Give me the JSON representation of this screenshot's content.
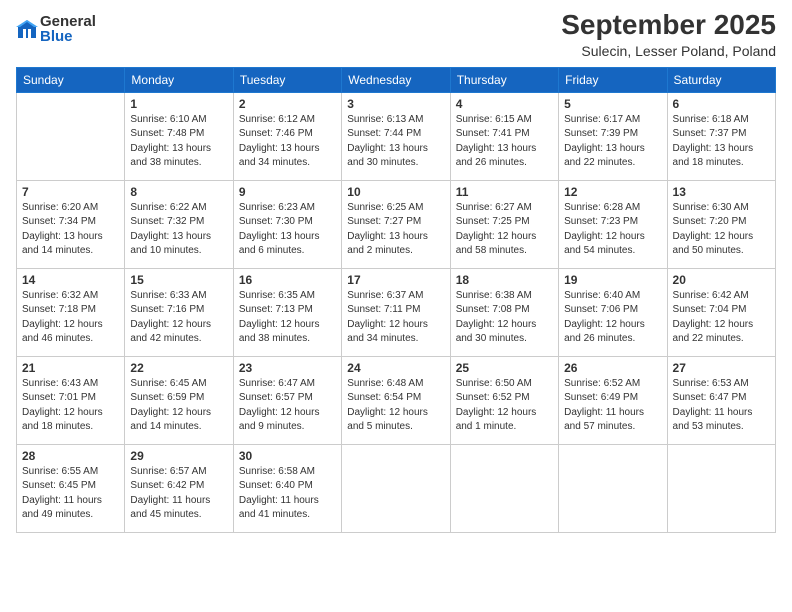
{
  "logo": {
    "general": "General",
    "blue": "Blue"
  },
  "header": {
    "month": "September 2025",
    "location": "Sulecin, Lesser Poland, Poland"
  },
  "days_of_week": [
    "Sunday",
    "Monday",
    "Tuesday",
    "Wednesday",
    "Thursday",
    "Friday",
    "Saturday"
  ],
  "weeks": [
    [
      {
        "day": "",
        "info": ""
      },
      {
        "day": "1",
        "info": "Sunrise: 6:10 AM\nSunset: 7:48 PM\nDaylight: 13 hours\nand 38 minutes."
      },
      {
        "day": "2",
        "info": "Sunrise: 6:12 AM\nSunset: 7:46 PM\nDaylight: 13 hours\nand 34 minutes."
      },
      {
        "day": "3",
        "info": "Sunrise: 6:13 AM\nSunset: 7:44 PM\nDaylight: 13 hours\nand 30 minutes."
      },
      {
        "day": "4",
        "info": "Sunrise: 6:15 AM\nSunset: 7:41 PM\nDaylight: 13 hours\nand 26 minutes."
      },
      {
        "day": "5",
        "info": "Sunrise: 6:17 AM\nSunset: 7:39 PM\nDaylight: 13 hours\nand 22 minutes."
      },
      {
        "day": "6",
        "info": "Sunrise: 6:18 AM\nSunset: 7:37 PM\nDaylight: 13 hours\nand 18 minutes."
      }
    ],
    [
      {
        "day": "7",
        "info": "Sunrise: 6:20 AM\nSunset: 7:34 PM\nDaylight: 13 hours\nand 14 minutes."
      },
      {
        "day": "8",
        "info": "Sunrise: 6:22 AM\nSunset: 7:32 PM\nDaylight: 13 hours\nand 10 minutes."
      },
      {
        "day": "9",
        "info": "Sunrise: 6:23 AM\nSunset: 7:30 PM\nDaylight: 13 hours\nand 6 minutes."
      },
      {
        "day": "10",
        "info": "Sunrise: 6:25 AM\nSunset: 7:27 PM\nDaylight: 13 hours\nand 2 minutes."
      },
      {
        "day": "11",
        "info": "Sunrise: 6:27 AM\nSunset: 7:25 PM\nDaylight: 12 hours\nand 58 minutes."
      },
      {
        "day": "12",
        "info": "Sunrise: 6:28 AM\nSunset: 7:23 PM\nDaylight: 12 hours\nand 54 minutes."
      },
      {
        "day": "13",
        "info": "Sunrise: 6:30 AM\nSunset: 7:20 PM\nDaylight: 12 hours\nand 50 minutes."
      }
    ],
    [
      {
        "day": "14",
        "info": "Sunrise: 6:32 AM\nSunset: 7:18 PM\nDaylight: 12 hours\nand 46 minutes."
      },
      {
        "day": "15",
        "info": "Sunrise: 6:33 AM\nSunset: 7:16 PM\nDaylight: 12 hours\nand 42 minutes."
      },
      {
        "day": "16",
        "info": "Sunrise: 6:35 AM\nSunset: 7:13 PM\nDaylight: 12 hours\nand 38 minutes."
      },
      {
        "day": "17",
        "info": "Sunrise: 6:37 AM\nSunset: 7:11 PM\nDaylight: 12 hours\nand 34 minutes."
      },
      {
        "day": "18",
        "info": "Sunrise: 6:38 AM\nSunset: 7:08 PM\nDaylight: 12 hours\nand 30 minutes."
      },
      {
        "day": "19",
        "info": "Sunrise: 6:40 AM\nSunset: 7:06 PM\nDaylight: 12 hours\nand 26 minutes."
      },
      {
        "day": "20",
        "info": "Sunrise: 6:42 AM\nSunset: 7:04 PM\nDaylight: 12 hours\nand 22 minutes."
      }
    ],
    [
      {
        "day": "21",
        "info": "Sunrise: 6:43 AM\nSunset: 7:01 PM\nDaylight: 12 hours\nand 18 minutes."
      },
      {
        "day": "22",
        "info": "Sunrise: 6:45 AM\nSunset: 6:59 PM\nDaylight: 12 hours\nand 14 minutes."
      },
      {
        "day": "23",
        "info": "Sunrise: 6:47 AM\nSunset: 6:57 PM\nDaylight: 12 hours\nand 9 minutes."
      },
      {
        "day": "24",
        "info": "Sunrise: 6:48 AM\nSunset: 6:54 PM\nDaylight: 12 hours\nand 5 minutes."
      },
      {
        "day": "25",
        "info": "Sunrise: 6:50 AM\nSunset: 6:52 PM\nDaylight: 12 hours\nand 1 minute."
      },
      {
        "day": "26",
        "info": "Sunrise: 6:52 AM\nSunset: 6:49 PM\nDaylight: 11 hours\nand 57 minutes."
      },
      {
        "day": "27",
        "info": "Sunrise: 6:53 AM\nSunset: 6:47 PM\nDaylight: 11 hours\nand 53 minutes."
      }
    ],
    [
      {
        "day": "28",
        "info": "Sunrise: 6:55 AM\nSunset: 6:45 PM\nDaylight: 11 hours\nand 49 minutes."
      },
      {
        "day": "29",
        "info": "Sunrise: 6:57 AM\nSunset: 6:42 PM\nDaylight: 11 hours\nand 45 minutes."
      },
      {
        "day": "30",
        "info": "Sunrise: 6:58 AM\nSunset: 6:40 PM\nDaylight: 11 hours\nand 41 minutes."
      },
      {
        "day": "",
        "info": ""
      },
      {
        "day": "",
        "info": ""
      },
      {
        "day": "",
        "info": ""
      },
      {
        "day": "",
        "info": ""
      }
    ]
  ]
}
